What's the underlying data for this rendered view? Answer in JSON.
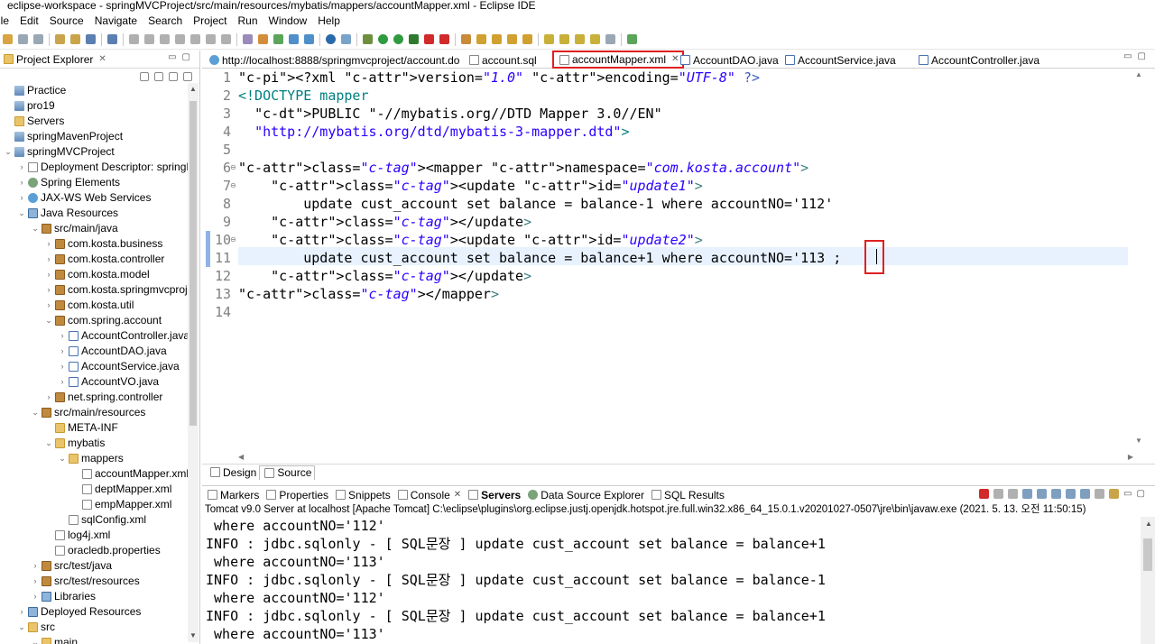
{
  "window": {
    "title": "eclipse-workspace - springMVCProject/src/main/resources/mybatis/mappers/accountMapper.xml - Eclipse IDE"
  },
  "menu": [
    "ile",
    "Edit",
    "Source",
    "Navigate",
    "Search",
    "Project",
    "Run",
    "Window",
    "Help"
  ],
  "project_explorer": {
    "title": "Project Explorer",
    "items": [
      {
        "label": "Practice",
        "indent": 0,
        "icon": "project-icon",
        "twisty": ""
      },
      {
        "label": "pro19",
        "indent": 0,
        "icon": "project-icon",
        "twisty": ""
      },
      {
        "label": "Servers",
        "indent": 0,
        "icon": "folder-icon",
        "twisty": ""
      },
      {
        "label": "springMavenProject",
        "indent": 0,
        "icon": "project-icon",
        "twisty": ""
      },
      {
        "label": "springMVCProject",
        "indent": 0,
        "icon": "project-icon",
        "twisty": "v"
      },
      {
        "label": "Deployment Descriptor: springMV",
        "indent": 1,
        "icon": "descriptor-icon",
        "twisty": ">"
      },
      {
        "label": "Spring Elements",
        "indent": 1,
        "icon": "spring-icon",
        "twisty": ">"
      },
      {
        "label": "JAX-WS Web Services",
        "indent": 1,
        "icon": "webservice-icon",
        "twisty": ">"
      },
      {
        "label": "Java Resources",
        "indent": 1,
        "icon": "java-resources-icon",
        "twisty": "v"
      },
      {
        "label": "src/main/java",
        "indent": 2,
        "icon": "source-folder-icon",
        "twisty": "v"
      },
      {
        "label": "com.kosta.business",
        "indent": 3,
        "icon": "package-icon",
        "twisty": ">"
      },
      {
        "label": "com.kosta.controller",
        "indent": 3,
        "icon": "package-icon",
        "twisty": ">"
      },
      {
        "label": "com.kosta.model",
        "indent": 3,
        "icon": "package-icon",
        "twisty": ">"
      },
      {
        "label": "com.kosta.springmvcproject",
        "indent": 3,
        "icon": "package-icon",
        "twisty": ">"
      },
      {
        "label": "com.kosta.util",
        "indent": 3,
        "icon": "package-icon",
        "twisty": ">"
      },
      {
        "label": "com.spring.account",
        "indent": 3,
        "icon": "package-icon",
        "twisty": "v"
      },
      {
        "label": "AccountController.java",
        "indent": 4,
        "icon": "java-file-icon",
        "twisty": ">"
      },
      {
        "label": "AccountDAO.java",
        "indent": 4,
        "icon": "java-file-icon",
        "twisty": ">"
      },
      {
        "label": "AccountService.java",
        "indent": 4,
        "icon": "java-file-icon",
        "twisty": ">"
      },
      {
        "label": "AccountVO.java",
        "indent": 4,
        "icon": "java-file-icon",
        "twisty": ">"
      },
      {
        "label": "net.spring.controller",
        "indent": 3,
        "icon": "package-icon",
        "twisty": ">"
      },
      {
        "label": "src/main/resources",
        "indent": 2,
        "icon": "source-folder-icon",
        "twisty": "v"
      },
      {
        "label": "META-INF",
        "indent": 3,
        "icon": "folder-icon",
        "twisty": ""
      },
      {
        "label": "mybatis",
        "indent": 3,
        "icon": "folder-icon",
        "twisty": "v"
      },
      {
        "label": "mappers",
        "indent": 4,
        "icon": "folder-icon",
        "twisty": "v"
      },
      {
        "label": "accountMapper.xml",
        "indent": 5,
        "icon": "xml-file-icon",
        "twisty": ""
      },
      {
        "label": "deptMapper.xml",
        "indent": 5,
        "icon": "xml-file-icon",
        "twisty": ""
      },
      {
        "label": "empMapper.xml",
        "indent": 5,
        "icon": "xml-file-icon",
        "twisty": ""
      },
      {
        "label": "sqlConfig.xml",
        "indent": 4,
        "icon": "xml-file-icon",
        "twisty": ""
      },
      {
        "label": "log4j.xml",
        "indent": 3,
        "icon": "xml-file-icon",
        "twisty": ""
      },
      {
        "label": "oracledb.properties",
        "indent": 3,
        "icon": "properties-file-icon",
        "twisty": ""
      },
      {
        "label": "src/test/java",
        "indent": 2,
        "icon": "source-folder-icon",
        "twisty": ">"
      },
      {
        "label": "src/test/resources",
        "indent": 2,
        "icon": "source-folder-icon",
        "twisty": ">"
      },
      {
        "label": "Libraries",
        "indent": 2,
        "icon": "library-icon",
        "twisty": ">"
      },
      {
        "label": "Deployed Resources",
        "indent": 1,
        "icon": "deployed-icon",
        "twisty": ">"
      },
      {
        "label": "src",
        "indent": 1,
        "icon": "folder-icon",
        "twisty": "v"
      },
      {
        "label": "main",
        "indent": 2,
        "icon": "folder-icon",
        "twisty": "v"
      }
    ]
  },
  "editor_tabs": [
    {
      "label": "http://localhost:8888/springmvcproject/account.do",
      "icon": "globe-icon",
      "active": false
    },
    {
      "label": "account.sql",
      "icon": "sql-file-icon",
      "active": false
    },
    {
      "label": "accountMapper.xml",
      "icon": "xml-file-icon",
      "active": true
    },
    {
      "label": "AccountDAO.java",
      "icon": "java-file-icon",
      "active": false
    },
    {
      "label": "AccountService.java",
      "icon": "java-file-icon",
      "active": false
    },
    {
      "label": "AccountController.java",
      "icon": "java-file-icon",
      "active": false
    }
  ],
  "code_lines": [
    {
      "n": "1",
      "text": "<?xml version=\"1.0\" encoding=\"UTF-8\" ?>"
    },
    {
      "n": "2",
      "text": "<!DOCTYPE mapper"
    },
    {
      "n": "3",
      "text": "  PUBLIC \"-//mybatis.org//DTD Mapper 3.0//EN\""
    },
    {
      "n": "4",
      "text": "  \"http://mybatis.org/dtd/mybatis-3-mapper.dtd\">"
    },
    {
      "n": "5",
      "text": ""
    },
    {
      "n": "6",
      "text": "<mapper namespace=\"com.kosta.account\">"
    },
    {
      "n": "7",
      "text": "    <update id=\"update1\">"
    },
    {
      "n": "8",
      "text": "        update cust_account set balance = balance-1 where accountNO='112'"
    },
    {
      "n": "9",
      "text": "    </update>"
    },
    {
      "n": "10",
      "text": "    <update id=\"update2\">"
    },
    {
      "n": "11",
      "text": "        update cust_account set balance = balance+1 where accountNO='113 ;"
    },
    {
      "n": "12",
      "text": "    </update>"
    },
    {
      "n": "13",
      "text": "</mapper>"
    },
    {
      "n": "14",
      "text": ""
    }
  ],
  "design_tabs": [
    {
      "label": "Design",
      "selected": false
    },
    {
      "label": "Source",
      "selected": true
    }
  ],
  "bottom_tabs": [
    {
      "label": "Markers",
      "bold": false,
      "close": false
    },
    {
      "label": "Properties",
      "bold": false,
      "close": false
    },
    {
      "label": "Snippets",
      "bold": false,
      "close": false
    },
    {
      "label": "Console",
      "bold": false,
      "close": true
    },
    {
      "label": "Servers",
      "bold": true,
      "close": false
    },
    {
      "label": "Data Source Explorer",
      "bold": false,
      "close": false
    },
    {
      "label": "SQL Results",
      "bold": false,
      "close": false
    }
  ],
  "console": {
    "info": "Tomcat v9.0 Server at localhost [Apache Tomcat] C:\\eclipse\\plugins\\org.eclipse.justj.openjdk.hotspot.jre.full.win32.x86_64_15.0.1.v20201027-0507\\jre\\bin\\javaw.exe  (2021. 5. 13. 오전 11:50:15)",
    "lines": [
      " where accountNO='112'",
      "INFO : jdbc.sqlonly - [ SQL문장 ] update cust_account set balance = balance+1",
      " where accountNO='113'",
      "INFO : jdbc.sqlonly - [ SQL문장 ] update cust_account set balance = balance-1",
      " where accountNO='112'",
      "INFO : jdbc.sqlonly - [ SQL문장 ] update cust_account set balance = balance+1",
      " where accountNO='113'"
    ]
  },
  "colors": {
    "highlight_box": "#e02020",
    "current_line": "#e8f2fe",
    "xml_tag": "#3f7f7f",
    "xml_attr": "#7f007f",
    "xml_value": "#2a00ff"
  }
}
